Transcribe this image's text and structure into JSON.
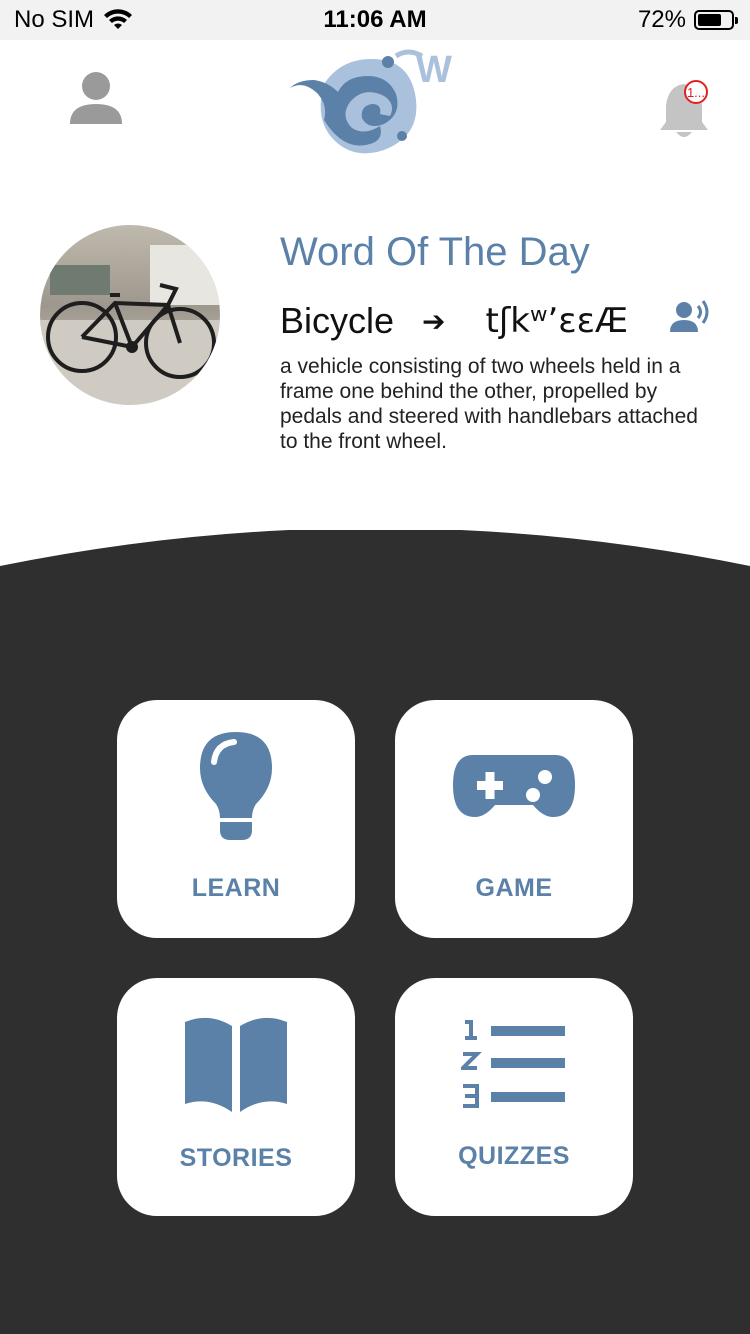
{
  "status_bar": {
    "carrier": "No SIM",
    "time": "11:06 AM",
    "battery_percent": "72%",
    "battery_level": 0.72
  },
  "header": {
    "profile_icon": "person-icon",
    "logo_icon": "app-logo",
    "notification_icon": "bell-icon",
    "notification_count": "1..."
  },
  "word_of_the_day": {
    "title": "Word Of The Day",
    "word": "Bicycle",
    "arrow": "➔",
    "phonetic": "tʃkʷ’ɛɛÆ",
    "definition": "a vehicle consisting of two wheels held in a frame one behind the other, propelled by pedals and steered with handlebars attached to the front wheel.",
    "image": "bicycle-photo",
    "speak_icon": "speaker-person-icon"
  },
  "menu": {
    "learn": "LEARN",
    "game": "GAME",
    "stories": "STORIES",
    "quizzes": "QUIZZES"
  },
  "colors": {
    "accent": "#5b81a8",
    "dark_bg": "#2f2f2f",
    "icon_gray": "#9a9a9a",
    "badge_red": "#e02020"
  }
}
